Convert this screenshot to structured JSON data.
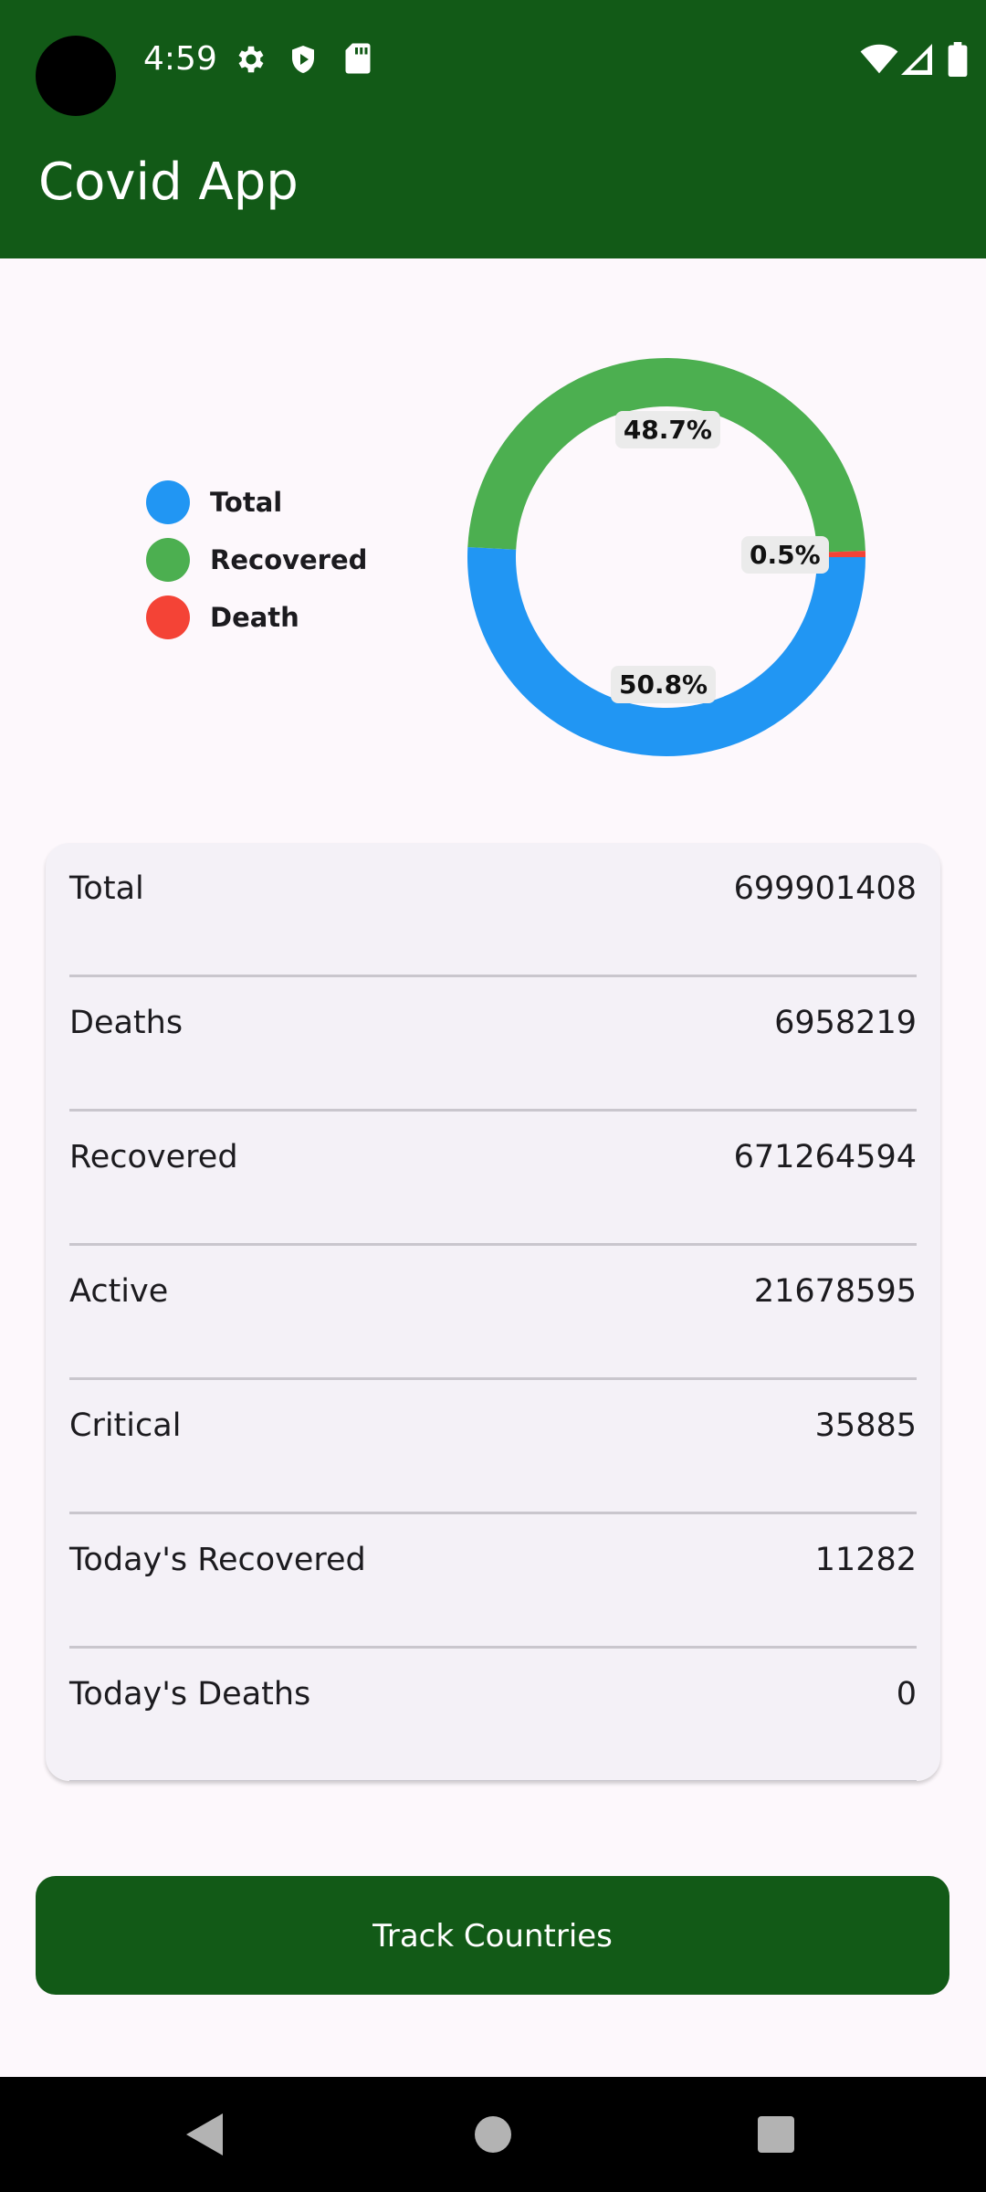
{
  "status_bar": {
    "time": "4:59"
  },
  "app_bar": {
    "title": "Covid App"
  },
  "legend": [
    {
      "label": "Total",
      "color": "#2196f3"
    },
    {
      "label": "Recovered",
      "color": "#4caf50"
    },
    {
      "label": "Death",
      "color": "#f44336"
    }
  ],
  "chart_data": {
    "type": "pie",
    "donut": true,
    "categories": [
      "Total",
      "Recovered",
      "Death"
    ],
    "values": [
      50.8,
      48.7,
      0.5
    ],
    "labels": [
      "50.8%",
      "48.7%",
      "0.5%"
    ],
    "colors": [
      "#2196f3",
      "#4caf50",
      "#f44336"
    ],
    "legend_position": "left"
  },
  "stats": [
    {
      "label": "Total",
      "value": "699901408"
    },
    {
      "label": "Deaths",
      "value": "6958219"
    },
    {
      "label": "Recovered",
      "value": "671264594"
    },
    {
      "label": "Active",
      "value": "21678595"
    },
    {
      "label": "Critical",
      "value": "35885"
    },
    {
      "label": "Today's Recovered",
      "value": "11282"
    },
    {
      "label": "Today's Deaths",
      "value": "0"
    }
  ],
  "actions": {
    "track_countries": "Track Countries"
  },
  "colors": {
    "primary": "#125a17",
    "background": "#fdf8fc",
    "card": "#f4f1f7"
  }
}
